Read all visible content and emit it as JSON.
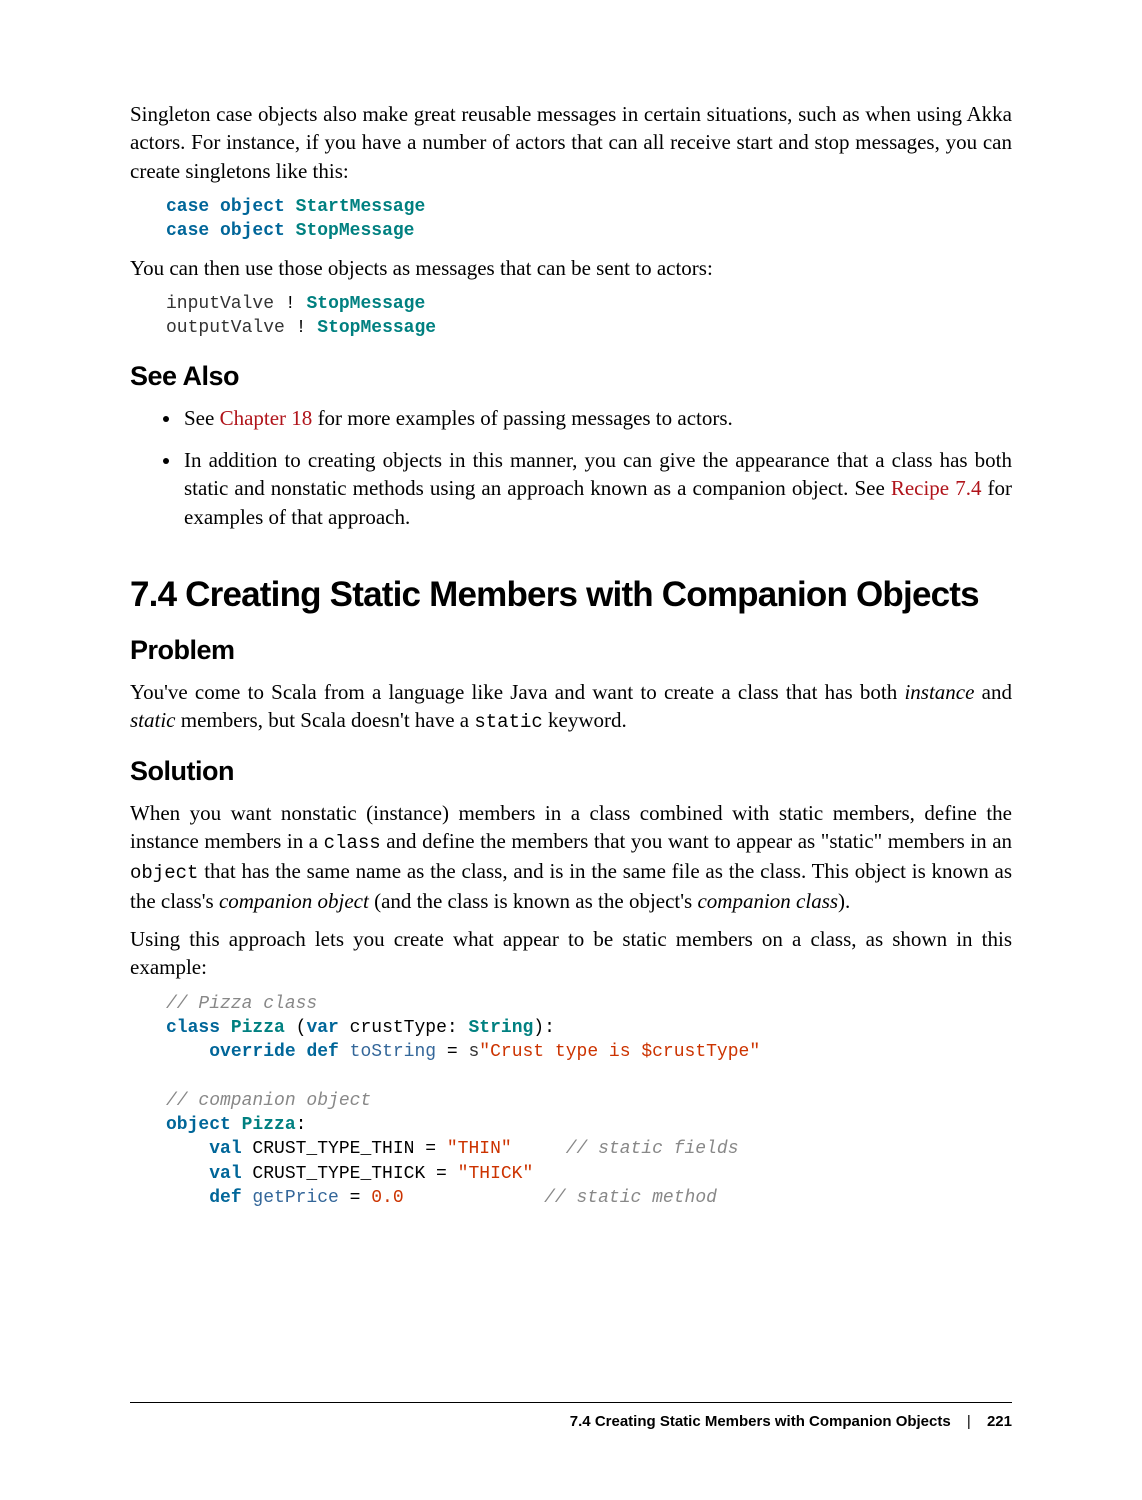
{
  "intro": {
    "para1": "Singleton case objects also make great reusable messages in certain situations, such as when using Akka actors. For instance, if you have a number of actors that can all receive start and stop messages, you can create singletons like this:",
    "para2": "You can then use those objects as messages that can be sent to actors:"
  },
  "code1": {
    "l1_kw1": "case",
    "l1_kw2": "object",
    "l1_type": "StartMessage",
    "l2_kw1": "case",
    "l2_kw2": "object",
    "l2_type": "StopMessage"
  },
  "code2": {
    "l1_id": "inputValve",
    "l1_op": "!",
    "l1_type": "StopMessage",
    "l2_id": "outputValve",
    "l2_op": "!",
    "l2_type": "StopMessage"
  },
  "see_also": {
    "heading": "See Also",
    "item1_pre": "See ",
    "item1_link": "Chapter 18",
    "item1_post": " for more examples of passing messages to actors.",
    "item2_pre": "In addition to creating objects in this manner, you can give the appearance that a class has both static and nonstatic methods using an approach known as a companion object. See ",
    "item2_link": "Recipe 7.4",
    "item2_post": " for examples of that approach."
  },
  "recipe": {
    "title": "7.4 Creating Static Members with Companion Objects"
  },
  "problem": {
    "heading": "Problem",
    "text_pre": "You've come to Scala from a language like Java and want to create a class that has both ",
    "em1": "instance",
    "mid1": " and ",
    "em2": "static",
    "mid2": " members, but Scala doesn't have a ",
    "mono": "static",
    "post": " keyword."
  },
  "solution": {
    "heading": "Solution",
    "p1_pre": "When you want nonstatic (instance) members in a class combined with static members, define the instance members in a ",
    "p1_m1": "class",
    "p1_mid": " and define the members that you want to appear as \"static\" members in an ",
    "p1_m2": "object",
    "p1_mid2": " that has the same name as the class, and is in the same file as the class. This object is known as the class's ",
    "p1_em1": "companion object",
    "p1_mid3": " (and the class is known as the object's ",
    "p1_em2": "companion class",
    "p1_post": ").",
    "p2": "Using this approach lets you create what appear to be static members on a class, as shown in this example:"
  },
  "code3": {
    "c1": "// Pizza class",
    "l2_kw": "class",
    "l2_type": "Pizza",
    "l2_paren1": " (",
    "l2_var": "var",
    "l2_id": " crustType: ",
    "l2_str": "String",
    "l2_paren2": "):",
    "l3_ind": "    ",
    "l3_ov": "override",
    "l3_def": "def",
    "l3_fn": " toString",
    "l3_eq": " = ",
    "l3_s": "s",
    "l3_str": "\"Crust type is $crustType\"",
    "c2": "// companion object",
    "l5_kw": "object",
    "l5_type": "Pizza",
    "l5_colon": ":",
    "l6_ind": "    ",
    "l6_val": "val",
    "l6_id": " CRUST_TYPE_THIN = ",
    "l6_str": "\"THIN\"",
    "l6_sp": "     ",
    "l6_c": "// static fields",
    "l7_ind": "    ",
    "l7_val": "val",
    "l7_id": " CRUST_TYPE_THICK = ",
    "l7_str": "\"THICK\"",
    "l8_ind": "    ",
    "l8_def": "def",
    "l8_fn": " getPrice",
    "l8_eq": " = ",
    "l8_num": "0.0",
    "l8_sp": "             ",
    "l8_c": "// static method"
  },
  "footer": {
    "title": "7.4 Creating Static Members with Companion Objects",
    "sep": "|",
    "page": "221"
  }
}
